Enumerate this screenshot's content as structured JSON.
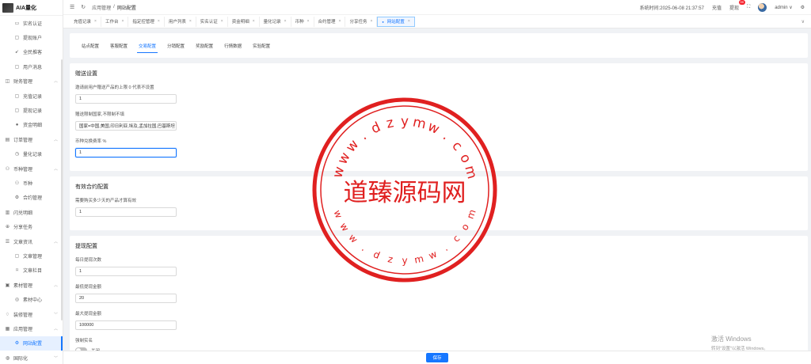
{
  "app": {
    "title": "AIA量化"
  },
  "sidebar": {
    "items": [
      {
        "label": "实名认证",
        "icon": "id-card-icon",
        "child": true
      },
      {
        "label": "提现账户",
        "icon": "folder-icon",
        "child": true
      },
      {
        "label": "全民推客",
        "icon": "rocket-icon",
        "child": true
      },
      {
        "label": "用户消息",
        "icon": "folder-icon",
        "child": true
      },
      {
        "label": "财务管理",
        "icon": "finance-icon",
        "child": false,
        "arrow": "^"
      },
      {
        "label": "充值记录",
        "icon": "folder-icon",
        "child": true
      },
      {
        "label": "提现记录",
        "icon": "folder-icon",
        "child": true
      },
      {
        "label": "资金明细",
        "icon": "apple-icon",
        "child": true
      },
      {
        "label": "订单管理",
        "icon": "order-icon",
        "child": false,
        "arrow": "^"
      },
      {
        "label": "量化记录",
        "icon": "clock-icon",
        "child": true
      },
      {
        "label": "币种管理",
        "icon": "coin-icon",
        "child": false,
        "arrow": "^"
      },
      {
        "label": "币种",
        "icon": "coin-icon",
        "child": true
      },
      {
        "label": "合约管理",
        "icon": "settings-icon",
        "child": true
      },
      {
        "label": "闪兑明细",
        "icon": "doc-icon",
        "child": false
      },
      {
        "label": "分享任务",
        "icon": "share-icon",
        "child": false
      },
      {
        "label": "文章资讯",
        "icon": "article-icon",
        "child": false,
        "arrow": "^"
      },
      {
        "label": "文章管理",
        "icon": "folder-icon",
        "child": true
      },
      {
        "label": "文章栏目",
        "icon": "bookmark-icon",
        "child": true
      },
      {
        "label": "素材管理",
        "icon": "image-icon",
        "child": false,
        "arrow": "^"
      },
      {
        "label": "素材中心",
        "icon": "circle-icon",
        "child": true
      },
      {
        "label": "装修管理",
        "icon": "decor-icon",
        "child": false,
        "arrow": "v"
      },
      {
        "label": "应用管理",
        "icon": "app-icon",
        "child": false,
        "arrow": "^"
      },
      {
        "label": "网站配置",
        "icon": "gear-icon",
        "child": true,
        "active": true
      },
      {
        "label": "国际化",
        "icon": "globe-icon",
        "child": false,
        "arrow": "v"
      }
    ]
  },
  "topbar": {
    "breadcrumb": [
      "应用管理",
      "网站配置"
    ],
    "system_time_label": "系统时间:",
    "system_time": "2025-06-08 21:37:57",
    "recharge": "充值",
    "withdraw": "提现",
    "withdraw_badge": "99",
    "username": "admin"
  },
  "tabs": [
    {
      "label": "充值记录"
    },
    {
      "label": "工作台"
    },
    {
      "label": "指定控管理"
    },
    {
      "label": "用户列表"
    },
    {
      "label": "实名认证"
    },
    {
      "label": "资金明细"
    },
    {
      "label": "量化记录"
    },
    {
      "label": "币种"
    },
    {
      "label": "合约管理"
    },
    {
      "label": "分享任务"
    },
    {
      "label": "网站配置",
      "active": true
    }
  ],
  "subtabs": [
    {
      "label": "站点配置"
    },
    {
      "label": "客服配置"
    },
    {
      "label": "交易配置",
      "active": true
    },
    {
      "label": "分销配置"
    },
    {
      "label": "奖励配置"
    },
    {
      "label": "行情数据"
    },
    {
      "label": "实验配置"
    }
  ],
  "sections": {
    "trade": {
      "title": "赠送设置",
      "f1_label": "邀请前用户赠送产品的上限 0 代表不设置",
      "f1_value": "1",
      "f2_label": "赠送限制国家,不限制不填",
      "f2_value": "国家=中国,美国,印日利亚,埃及,孟加拉国,巴基斯坦",
      "f3_label": "币种兑换费率 %",
      "f3_value": "1"
    },
    "contract": {
      "title": "有效合约配置",
      "f1_label": "需要购买多少天的产品才算有效",
      "f1_value": "1"
    },
    "withdraw": {
      "title": "提现配置",
      "f1_label": "每日提现次数",
      "f1_value": "1",
      "f2_label": "最低提现金额",
      "f2_value": "20",
      "f3_label": "最大提现金额",
      "f3_value": "100000",
      "f4_label": "强制实名",
      "switch_label": "关闭",
      "switch_on": false
    }
  },
  "save_label": "保存",
  "watermark": {
    "center": "道臻源码网",
    "ring_top": [
      "w",
      "w",
      "w",
      ".",
      "d",
      "z",
      "y",
      "m",
      "w",
      ".",
      "c",
      "o",
      "m"
    ],
    "ring_bottom": [
      "w",
      "w",
      "w",
      ".",
      "d",
      "z",
      "y",
      "m",
      "w",
      ".",
      "c",
      "o",
      "m"
    ],
    "color": "#e02020"
  },
  "os_notice": {
    "line1": "激活 Windows",
    "line2": "转到\"设置\"以激活 Windows。"
  }
}
